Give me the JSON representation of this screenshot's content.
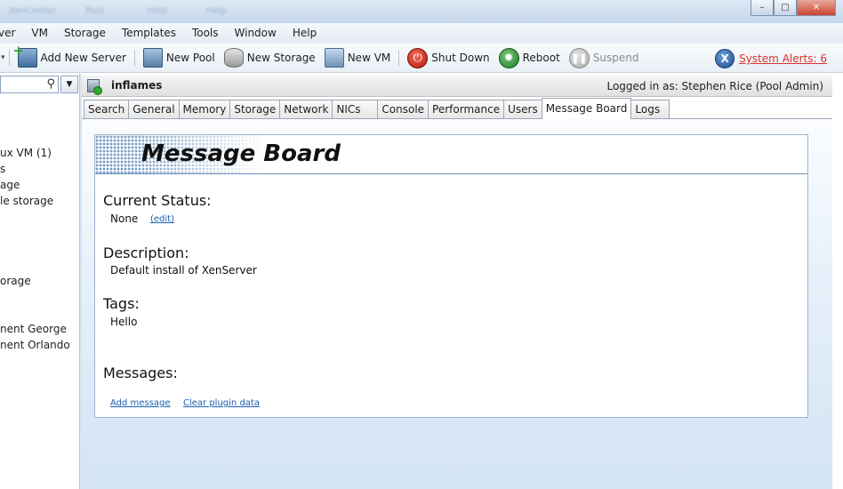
{
  "window": {
    "blurred_title_parts": [
      "XenCenter",
      "Pool",
      "Host",
      "Help"
    ],
    "min_glyph": "–",
    "max_glyph": "□",
    "close_glyph": "✕"
  },
  "menu": [
    "ver",
    "VM",
    "Storage",
    "Templates",
    "Tools",
    "Window",
    "Help"
  ],
  "toolbar": {
    "add_server": "Add New Server",
    "new_pool": "New Pool",
    "new_storage": "New Storage",
    "new_vm": "New VM",
    "shut_down": "Shut Down",
    "reboot": "Reboot",
    "suspend": "Suspend"
  },
  "alerts": {
    "label": "System Alerts: 6",
    "icon": "x-alert-icon"
  },
  "tree": [
    "ux VM (1)",
    "s",
    "age",
    "le storage",
    "orage",
    "nent George",
    "nent Orlando"
  ],
  "header": {
    "host_name": "inflames",
    "logged_in": "Logged in as:  Stephen Rice (Pool Admin)"
  },
  "tabs": [
    "Search",
    "General",
    "Memory",
    "Storage",
    "Network",
    "NICs",
    "Console",
    "Performance",
    "Users",
    "Message Board",
    "Logs"
  ],
  "active_tab": "Message Board",
  "board": {
    "title": "Message Board",
    "status_label": "Current Status:",
    "status_value": "None",
    "edit_link": "(edit)",
    "description_label": "Description:",
    "description_value": "Default install of XenServer",
    "tags_label": "Tags:",
    "tags_value": "Hello",
    "messages_label": "Messages:",
    "add_message": "Add message",
    "clear_plugin": "Clear plugin data"
  },
  "colors": {
    "alert_red": "#d9322b",
    "link_blue": "#1a5fb0",
    "shutdown_red": "#b3170d",
    "reboot_green": "#1f7d25"
  }
}
